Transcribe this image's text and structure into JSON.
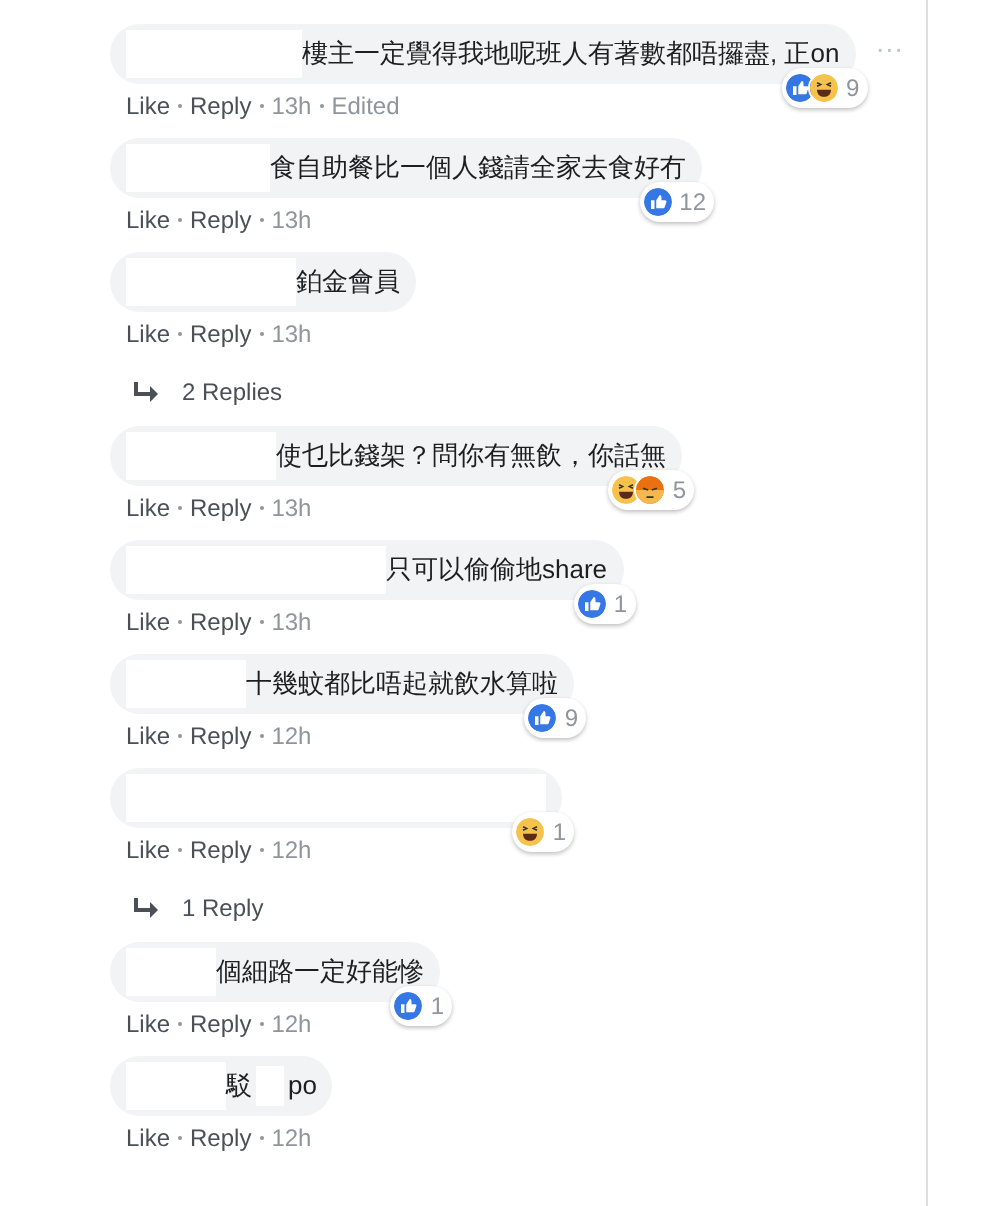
{
  "comments": [
    {
      "segments": [
        "樓主一定覺得我地呢班人有著數都唔攞盡, 正on"
      ],
      "reactions": [
        {
          "kind": "like"
        },
        {
          "kind": "haha"
        }
      ],
      "reaction_count": "9",
      "actions": [
        "Like",
        "Reply",
        "13h",
        "Edited"
      ],
      "more": "···"
    },
    {
      "segments": [
        "食自助餐比一個人錢請全家去食好冇"
      ],
      "reactions": [
        {
          "kind": "like"
        }
      ],
      "reaction_count": "12",
      "actions": [
        "Like",
        "Reply",
        "13h"
      ]
    },
    {
      "segments": [
        "鉑金會員"
      ],
      "actions": [
        "Like",
        "Reply",
        "13h"
      ],
      "replies": "2 Replies"
    },
    {
      "segments": [
        "使乜比錢架？問你有無飲，你話無"
      ],
      "reactions": [
        {
          "kind": "haha"
        },
        {
          "kind": "angry"
        }
      ],
      "reaction_count": "5",
      "actions": [
        "Like",
        "Reply",
        "13h"
      ]
    },
    {
      "segments": [
        "只可以偷偷地share"
      ],
      "reactions": [
        {
          "kind": "like"
        }
      ],
      "reaction_count": "1",
      "actions": [
        "Like",
        "Reply",
        "13h"
      ]
    },
    {
      "segments": [
        "十幾蚊都比唔起就飲水算啦"
      ],
      "reactions": [
        {
          "kind": "like"
        }
      ],
      "reaction_count": "9",
      "actions": [
        "Like",
        "Reply",
        "12h"
      ]
    },
    {
      "reactions": [
        {
          "kind": "haha"
        }
      ],
      "reaction_count": "1",
      "actions": [
        "Like",
        "Reply",
        "12h"
      ],
      "replies": "1 Reply"
    },
    {
      "segments": [
        "個細路一定好能慘"
      ],
      "reactions": [
        {
          "kind": "like"
        }
      ],
      "reaction_count": "1",
      "actions": [
        "Like",
        "Reply",
        "12h"
      ]
    },
    {
      "segments": [
        "駁",
        "po"
      ],
      "actions": [
        "Like",
        "Reply",
        "12h"
      ]
    }
  ]
}
